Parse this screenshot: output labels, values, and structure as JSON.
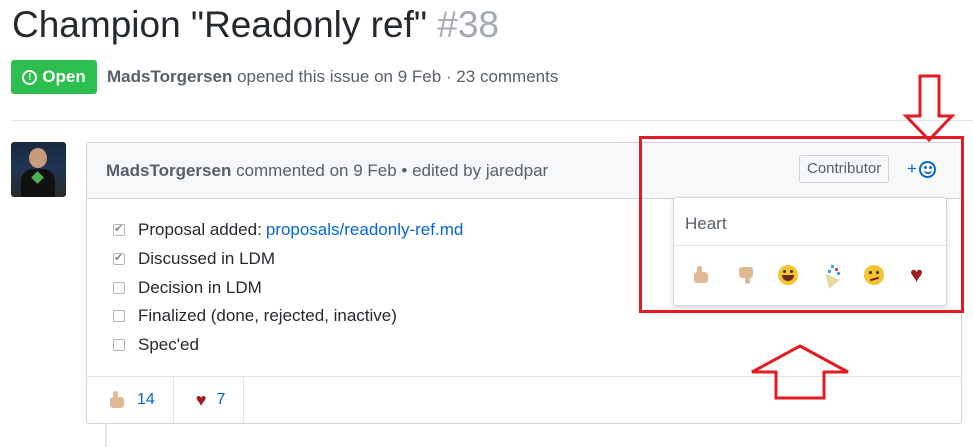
{
  "issue": {
    "title": "Champion \"Readonly ref\"",
    "number": "#38",
    "state": "Open",
    "state_icon": "exclamation-circle-icon",
    "author": "MadsTorgersen",
    "meta_text": "opened this issue on 9 Feb · 23 comments"
  },
  "comment": {
    "author": "MadsTorgersen",
    "meta": "commented on 9 Feb • edited by jaredpar",
    "role_badge": "Contributor",
    "add_reaction": "+",
    "tasks": [
      {
        "label": "Proposal added: ",
        "link": "proposals/readonly-ref.md",
        "checked": true
      },
      {
        "label": "Discussed in LDM",
        "checked": true
      },
      {
        "label": "Decision in LDM",
        "checked": false
      },
      {
        "label": "Finalized (done, rejected, inactive)",
        "checked": false
      },
      {
        "label": "Spec'ed",
        "checked": false
      }
    ],
    "reactions": [
      {
        "emoji": "thumbs-up",
        "count": "14"
      },
      {
        "emoji": "heart",
        "count": "7"
      }
    ]
  },
  "reaction_popover": {
    "hover_label": "Heart",
    "options": [
      "thumbs-up",
      "thumbs-down",
      "laugh",
      "hooray",
      "confused",
      "heart"
    ]
  },
  "colors": {
    "open_green": "#2cbe4e",
    "link_blue": "#0366d6",
    "annotation_red": "#e31b23",
    "heart": "#a01c1c"
  }
}
